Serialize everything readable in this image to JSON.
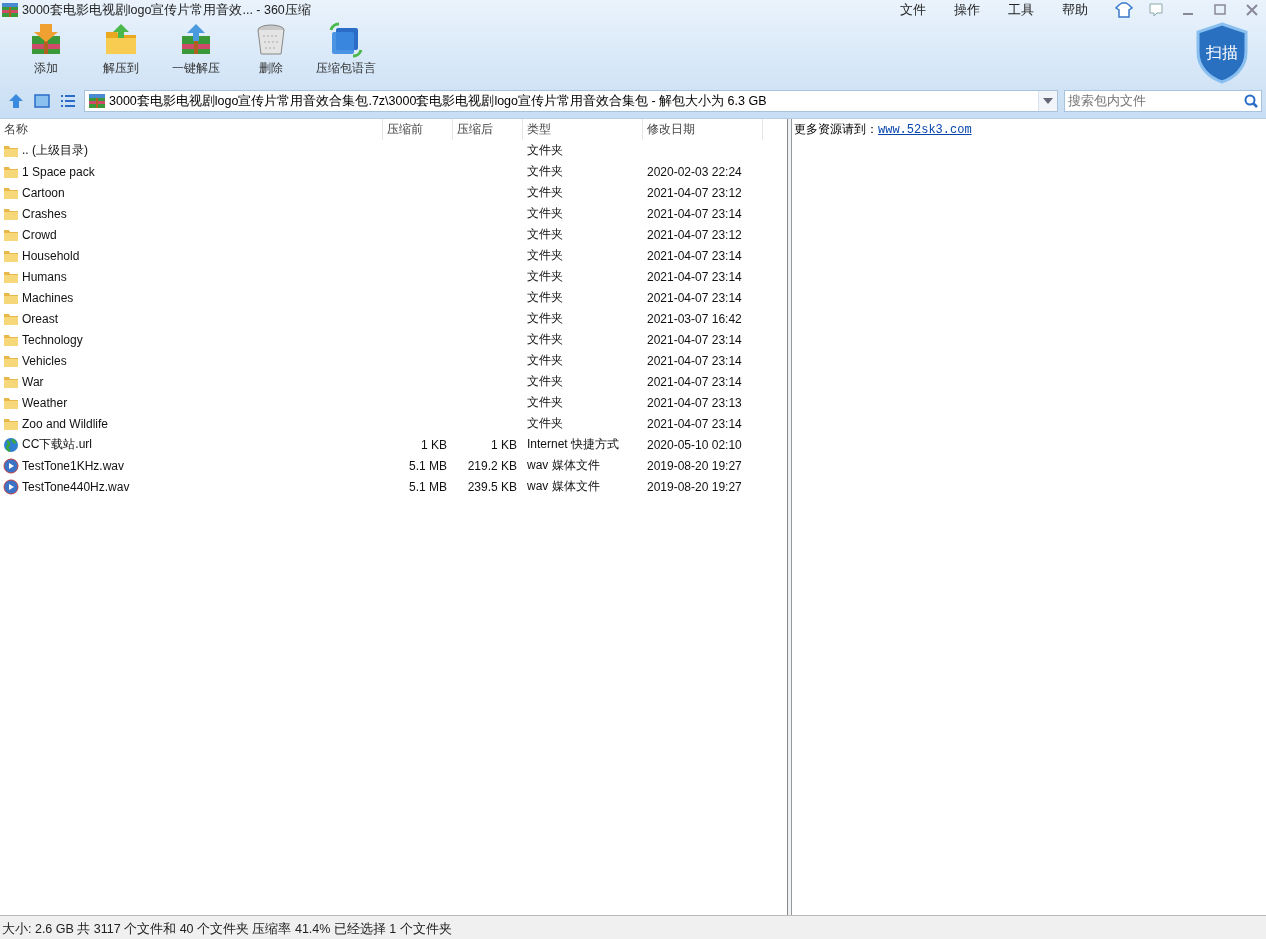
{
  "window": {
    "title": "3000套电影电视剧logo宣传片常用音效... - 360压缩"
  },
  "menu": [
    "文件",
    "操作",
    "工具",
    "帮助"
  ],
  "toolbar": [
    {
      "label": "添加",
      "kind": "add"
    },
    {
      "label": "解压到",
      "kind": "extract"
    },
    {
      "label": "一键解压",
      "kind": "oneclick"
    },
    {
      "label": "删除",
      "kind": "delete"
    },
    {
      "label": "压缩包语言",
      "kind": "encoding"
    }
  ],
  "scan_button": "扫描",
  "address": "3000套电影电视剧logo宣传片常用音效合集包.7z\\3000套电影电视剧logo宣传片常用音效合集包 - 解包大小为 6.3 GB",
  "search": {
    "placeholder": "搜索包内文件"
  },
  "table": {
    "columns": [
      "名称",
      "压缩前",
      "压缩后",
      "类型",
      "修改日期"
    ],
    "rows": [
      {
        "kind": "folder",
        "name": ".. (上级目录)",
        "type": "文件夹"
      },
      {
        "kind": "folder",
        "name": "1 Space pack",
        "type": "文件夹",
        "modified": "2020-02-03 22:24"
      },
      {
        "kind": "folder",
        "name": "Cartoon",
        "type": "文件夹",
        "modified": "2021-04-07 23:12"
      },
      {
        "kind": "folder",
        "name": "Crashes",
        "type": "文件夹",
        "modified": "2021-04-07 23:14"
      },
      {
        "kind": "folder",
        "name": "Crowd",
        "type": "文件夹",
        "modified": "2021-04-07 23:12"
      },
      {
        "kind": "folder",
        "name": "Household",
        "type": "文件夹",
        "modified": "2021-04-07 23:14"
      },
      {
        "kind": "folder",
        "name": "Humans",
        "type": "文件夹",
        "modified": "2021-04-07 23:14"
      },
      {
        "kind": "folder",
        "name": "Machines",
        "type": "文件夹",
        "modified": "2021-04-07 23:14"
      },
      {
        "kind": "folder",
        "name": "Oreast",
        "type": "文件夹",
        "modified": "2021-03-07 16:42"
      },
      {
        "kind": "folder",
        "name": "Technology",
        "type": "文件夹",
        "modified": "2021-04-07 23:14"
      },
      {
        "kind": "folder",
        "name": "Vehicles",
        "type": "文件夹",
        "modified": "2021-04-07 23:14"
      },
      {
        "kind": "folder",
        "name": "War",
        "type": "文件夹",
        "modified": "2021-04-07 23:14"
      },
      {
        "kind": "folder",
        "name": "Weather",
        "type": "文件夹",
        "modified": "2021-04-07 23:13"
      },
      {
        "kind": "folder",
        "name": "Zoo and Wildlife",
        "type": "文件夹",
        "modified": "2021-04-07 23:14"
      },
      {
        "kind": "url",
        "name": "CC下载站.url",
        "size": "1 KB",
        "packed": "1 KB",
        "type": "Internet 快捷方式",
        "modified": "2020-05-10 02:10"
      },
      {
        "kind": "wav",
        "name": "TestTone1KHz.wav",
        "size": "5.1 MB",
        "packed": "219.2 KB",
        "type": "wav 媒体文件",
        "modified": "2019-08-20 19:27"
      },
      {
        "kind": "wav",
        "name": "TestTone440Hz.wav",
        "size": "5.1 MB",
        "packed": "239.5 KB",
        "type": "wav 媒体文件",
        "modified": "2019-08-20 19:27"
      }
    ]
  },
  "info_panel": {
    "text": "更多资源请到：",
    "link": "www.52sk3.com"
  },
  "status_bar": "大小: 2.6 GB 共 3117 个文件和 40 个文件夹 压缩率 41.4% 已经选择 1 个文件夹"
}
